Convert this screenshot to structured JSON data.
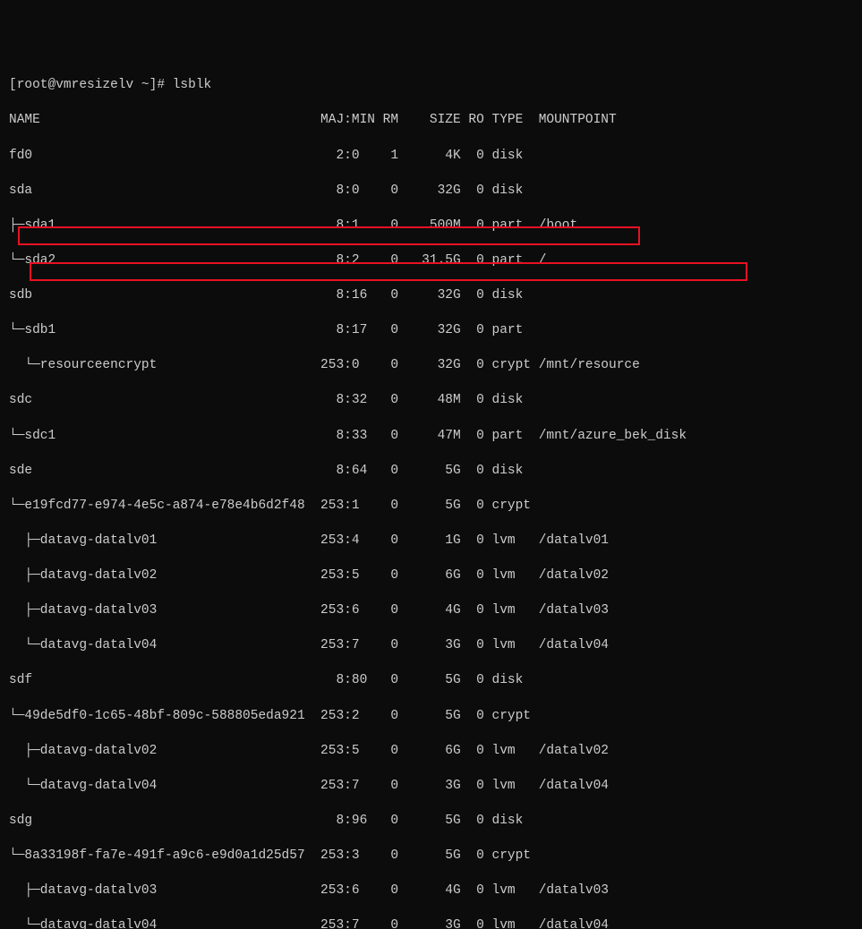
{
  "prompt": "[root@vmresizelv ~]# lsblk",
  "header": "NAME                                    MAJ:MIN RM    SIZE RO TYPE  MOUNTPOINT",
  "rows": [
    "fd0                                       2:0    1      4K  0 disk",
    "sda                                       8:0    0     32G  0 disk",
    "├─sda1                                    8:1    0    500M  0 part  /boot",
    "└─sda2                                    8:2    0   31.5G  0 part  /",
    "sdb                                       8:16   0     32G  0 disk",
    "└─sdb1                                    8:17   0     32G  0 part",
    "  └─resourceencrypt                     253:0    0     32G  0 crypt /mnt/resource",
    "sdc                                       8:32   0     48M  0 disk",
    "└─sdc1                                    8:33   0     47M  0 part  /mnt/azure_bek_disk",
    "sde                                       8:64   0      5G  0 disk",
    "└─e19fcd77-e974-4e5c-a874-e78e4b6d2f48  253:1    0      5G  0 crypt",
    "  ├─datavg-datalv01                     253:4    0      1G  0 lvm   /datalv01",
    "  ├─datavg-datalv02                     253:5    0      6G  0 lvm   /datalv02",
    "  ├─datavg-datalv03                     253:6    0      4G  0 lvm   /datalv03",
    "  └─datavg-datalv04                     253:7    0      3G  0 lvm   /datalv04",
    "sdf                                       8:80   0      5G  0 disk",
    "└─49de5df0-1c65-48bf-809c-588805eda921  253:2    0      5G  0 crypt",
    "  ├─datavg-datalv02                     253:5    0      6G  0 lvm   /datalv02",
    "  └─datavg-datalv04                     253:7    0      3G  0 lvm   /datalv04",
    "sdg                                       8:96   0      5G  0 disk",
    "└─8a33198f-fa7e-491f-a9c6-e9d0a1d25d57  253:3    0      5G  0 crypt",
    "  ├─datavg-datalv03                     253:6    0      4G  0 lvm   /datalv03",
    "  └─datavg-datalv04                     253:7    0      3G  0 lvm   /datalv04"
  ]
}
